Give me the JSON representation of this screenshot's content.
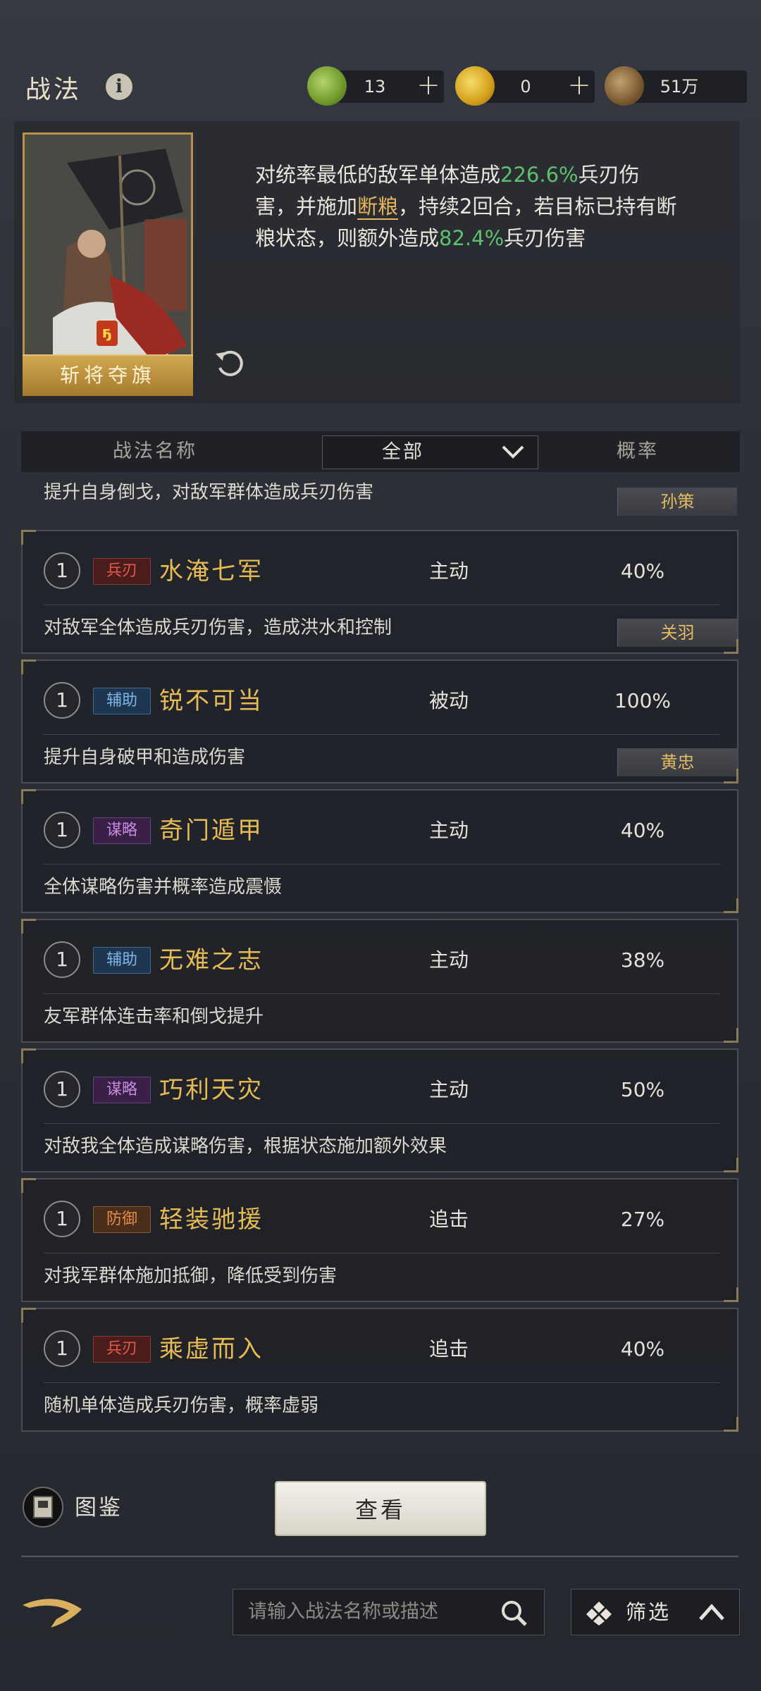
{
  "header": {
    "title": "战法",
    "info_icon": "info-icon",
    "resources": [
      {
        "icon": "jade-coin-icon",
        "value": "13",
        "color": "#7fa83a"
      },
      {
        "icon": "gold-coin-icon",
        "value": "0",
        "color": "#d9a821"
      },
      {
        "icon": "copper-coin-icon",
        "value": "51万",
        "color": "#8a6a3a"
      }
    ],
    "plus": "+"
  },
  "featured": {
    "name": "斩将夺旗",
    "desc_parts": [
      "对统率最低的敌军单体造成",
      "226.6%",
      "兵刃伤害，并施加",
      "断粮",
      "，持续2回合，若目标已持有断粮状态，则额外造成",
      "82.4%",
      "兵刃伤害"
    ],
    "highlight_green": "#5cc06c",
    "highlight_orange": "#e6b75a"
  },
  "table": {
    "col_name": "战法名称",
    "filter_value": "全部",
    "col_prob": "概率"
  },
  "partial_row": {
    "desc": "提升自身倒戈，对敌军群体造成兵刃伤害",
    "owner": "孙策"
  },
  "rows": [
    {
      "level": "1",
      "tag": "兵刃",
      "name": "水淹七军",
      "type": "主动",
      "prob": "40%",
      "desc": "对敌军全体造成兵刃伤害，造成洪水和控制",
      "owner": "关羽"
    },
    {
      "level": "1",
      "tag": "辅助",
      "name": "锐不可当",
      "type": "被动",
      "prob": "100%",
      "desc": "提升自身破甲和造成伤害",
      "owner": "黄忠"
    },
    {
      "level": "1",
      "tag": "谋略",
      "name": "奇门遁甲",
      "type": "主动",
      "prob": "40%",
      "desc": "全体谋略伤害并概率造成震慑",
      "owner": ""
    },
    {
      "level": "1",
      "tag": "辅助",
      "name": "无难之志",
      "type": "主动",
      "prob": "38%",
      "desc": "友军群体连击率和倒戈提升",
      "owner": ""
    },
    {
      "level": "1",
      "tag": "谋略",
      "name": "巧利天灾",
      "type": "主动",
      "prob": "50%",
      "desc": "对敌我全体造成谋略伤害，根据状态施加额外效果",
      "owner": ""
    },
    {
      "level": "1",
      "tag": "防御",
      "name": "轻装驰援",
      "type": "追击",
      "prob": "27%",
      "desc": "对我军群体施加抵御，降低受到伤害",
      "owner": ""
    },
    {
      "level": "1",
      "tag": "兵刃",
      "name": "乘虚而入",
      "type": "追击",
      "prob": "40%",
      "desc": "随机单体造成兵刃伤害，概率虚弱",
      "owner": ""
    }
  ],
  "footer": {
    "book_label": "图鉴",
    "view_button": "查看",
    "search_placeholder": "请输入战法名称或描述",
    "filter_label": "筛选"
  }
}
